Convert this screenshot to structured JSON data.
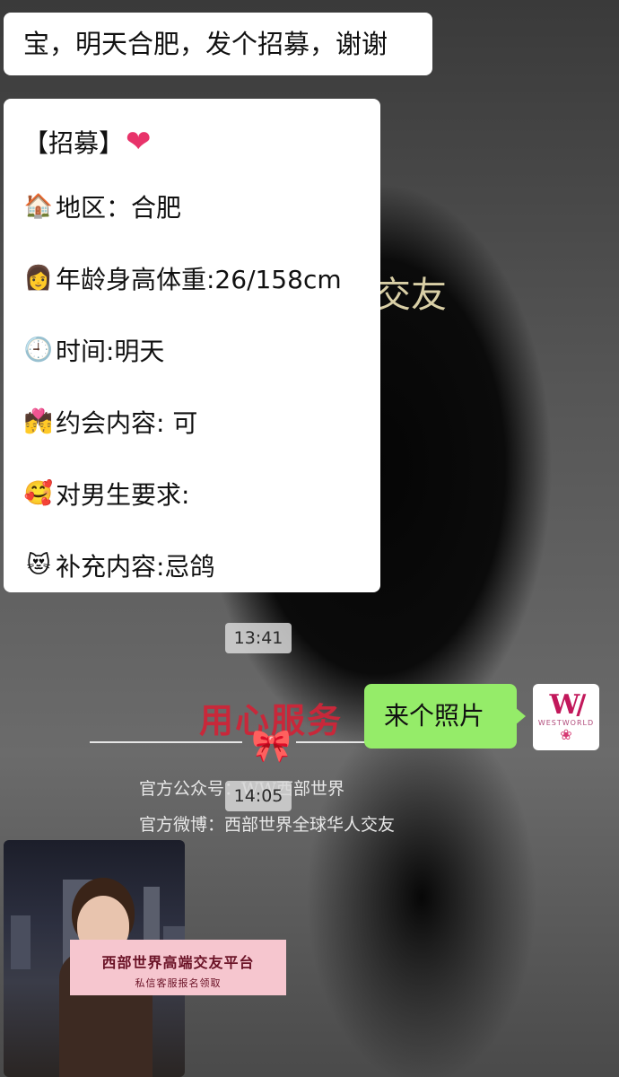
{
  "wallpaper": {
    "title_partial": "交友",
    "slogan": "用心服务",
    "official_account": "官方公众号：WW西部世界",
    "official_weibo": "官方微博：西部世界全球华人交友"
  },
  "messages": {
    "top_request": "宝，明天合肥，发个招募，谢谢",
    "recruit_form": {
      "title": "【招募】",
      "title_icon": "heart-emoji",
      "lines": [
        {
          "icon": "house-emoji",
          "glyph": "🏠",
          "text": "地区：合肥"
        },
        {
          "icon": "woman-emoji",
          "glyph": "👩",
          "text": "年龄身高体重:26/158cm"
        },
        {
          "icon": "clock-emoji",
          "glyph": "🕘",
          "text": "时间:明天"
        },
        {
          "icon": "couple-kiss-emoji",
          "glyph": "💏",
          "text": "约会内容: 可"
        },
        {
          "icon": "smiling-hearts-emoji",
          "glyph": "🥰",
          "text": "对男生要求:"
        },
        {
          "icon": "heart-eyes-cat-emoji",
          "glyph": "😻",
          "text": "补充内容:忌鸽"
        }
      ]
    },
    "time_1": "13:41",
    "reply": "来个照片",
    "time_2": "14:05",
    "avatar": {
      "logo": "W/",
      "brand": "WESTWORLD",
      "rose": "❀"
    },
    "photo": {
      "banner_main": "西部世界高端交友平台",
      "banner_sub": "私信客服报名领取"
    }
  },
  "colors": {
    "bubble_white": "#ffffff",
    "bubble_green": "#95ec69",
    "slogan_red": "#c8283a",
    "banner_pink": "#f6c6cf"
  }
}
